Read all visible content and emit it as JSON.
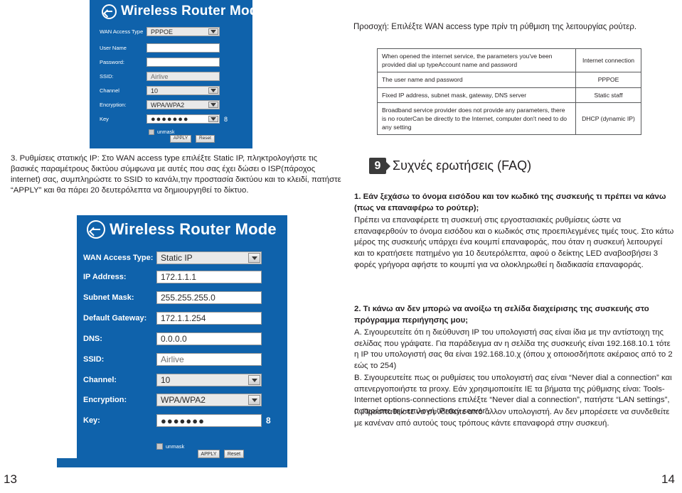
{
  "panel_top": {
    "title": "Wireless Router Mode",
    "back_icon": "back-arrow-icon",
    "fields": [
      {
        "label": "WAN Access Type",
        "value": "PPPOE",
        "type": "select"
      },
      {
        "label": "User Name",
        "value": "",
        "type": "text"
      },
      {
        "label": "Password:",
        "value": "",
        "type": "text"
      },
      {
        "label": "SSID:",
        "value": "Airlive",
        "type": "text"
      },
      {
        "label": "Channel",
        "value": "10",
        "type": "select"
      },
      {
        "label": "Encryption:",
        "value": "WPA/WPA2",
        "type": "select"
      },
      {
        "label": "Key",
        "value": "●●●●●●●",
        "type": "password",
        "suffix": "8"
      }
    ],
    "unmask_label": "unmask",
    "apply_label": "APPLY",
    "reset_label": "Reset"
  },
  "notice": "Προσοχή: Επιλέξτε WAN access type πρίν τη ρύθμιση της λειτουργίας ρούτερ.",
  "wan_table": {
    "rows": [
      {
        "description": "When opened the internet service, the parameters you've been provided  dial up typeAccount name and password",
        "type": "Internet connection"
      },
      {
        "description": "The user name and password",
        "type": "PPPOE"
      },
      {
        "description": "Fixed IP address, subnet mask, gateway, DNS server",
        "type": "Static staff"
      },
      {
        "description": "Broadband service provider does not provide any parameters, there is no routerCan be directly to the Internet, computer don't need to do any setting",
        "type": "DHCP (dynamic IP)"
      }
    ]
  },
  "step3": "3. Ρυθμίσεις στατικής IP: Στο WAN access type επιλέξτε Static IP, πληκτρολογήστε τις βασικές παραμέτρους δικτύου σύμφωνα με αυτές που σας έχει δώσει ο ISP(πάροχος internet) σας, συμπληρώστε το SSID το κανάλι,την προστασία δικτύου και το κλειδί, πατήστε “APPLY” και θα πάρει 20 δευτερόλεπτα να δημιουργηθεί το δίκτυο.",
  "panel_bottom": {
    "title": "Wireless Router Mode",
    "back_icon": "back-arrow-icon",
    "fields": [
      {
        "label": "WAN Access Type:",
        "value": "Static IP",
        "type": "select"
      },
      {
        "label": "IP Address:",
        "value": "172.1.1.1",
        "type": "text"
      },
      {
        "label": "Subnet Mask:",
        "value": "255.255.255.0",
        "type": "text"
      },
      {
        "label": "Default Gateway:",
        "value": "172.1.1.254",
        "type": "text"
      },
      {
        "label": "DNS:",
        "value": "0.0.0.0",
        "type": "text"
      },
      {
        "label": "SSID:",
        "value": "Airlive",
        "type": "text"
      },
      {
        "label": "Channel:",
        "value": "10",
        "type": "select"
      },
      {
        "label": "Encryption:",
        "value": "WPA/WPA2",
        "type": "select"
      },
      {
        "label": "Key:",
        "value": "●●●●●●●",
        "type": "password",
        "suffix": "8"
      }
    ],
    "unmask_label": "unmask",
    "apply_label": "APPLY",
    "reset_label": "Reset"
  },
  "faq": {
    "badge": "9",
    "title": "Συχνές ερωτήσεις (FAQ)",
    "q1": "1. Εάν ξεχάσω το όνομα εισόδου και τον κωδικό της συσκευής τι πρέπει να κάνω (πως να επαναφέρω το ρούτερ);",
    "a1": "Πρέπει να επαναφέρετε τη συσκευή στις εργοστασιακές ρυθμίσεις ώστε να επαναφερθούν το όνομα εισόδου και ο κωδικός στις προεπιλεγμένες τιμές τους. Στο κάτω μέρος της συσκευής υπάρχει ένα κουμπί επαναφοράς, που όταν η συσκευή λειτουργεί και το κρατήσετε πατημένο για 10 δευτερόλεπτα, αφού ο δείκτης LED αναβοσβήσει 3 φορές γρήγορα αφήστε το κουμπί για να ολοκληρωθεί η διαδικασία επαναφοράς.",
    "q2": "2. Τι κάνω αν δεν μπορώ να ανοίξω τη σελίδα διαχείρισης της συσκευής στο πρόγραμμα περιήγησης μου;",
    "a2a": "Α. Σιγουρευτείτε ότι η διεύθυνση IP του υπολογιστή σας είναι ίδια με την αντίστοιχη της σελίδας που γράψατε. Για παράδειγμα αν η σελίδα της συσκευής είναι 192.168.10.1 τότε η IP του υπολογιστή σας θα είναι 192.168.10.χ (όπου χ οποιοσδήποτε ακέραιος από το 2 εώς το 254)",
    "a2b": "Β. Σιγουρευτείτε πως οι ρυθμίσεις του υπολογιστή σας είναι “Never dial a connection” και απενεργοποιήστε τα proxy. Εάν χρησιμοποιείτε IE τα βήματα της ρύθμισης είναι: Tools-Internet options-connections επιλέξτε “Never dial a connection”, πατήστε “LAN settings”, αφαιρέστε την επιλογή “Proxy server”.",
    "a2c": "Γ. Προσπαθείστε να συνδεθείτε από άλλον υπολογιστή. Αν δεν μπορέσετε να συνδεθείτε με κανέναν από αυτούς τους τρόπους κάντε επαναφορά στην συσκευή."
  },
  "page_left": "13",
  "page_right": "14",
  "colors": {
    "panel_blue": "#0f62ab",
    "text": "#231f20",
    "badge": "#3b3b3b"
  }
}
